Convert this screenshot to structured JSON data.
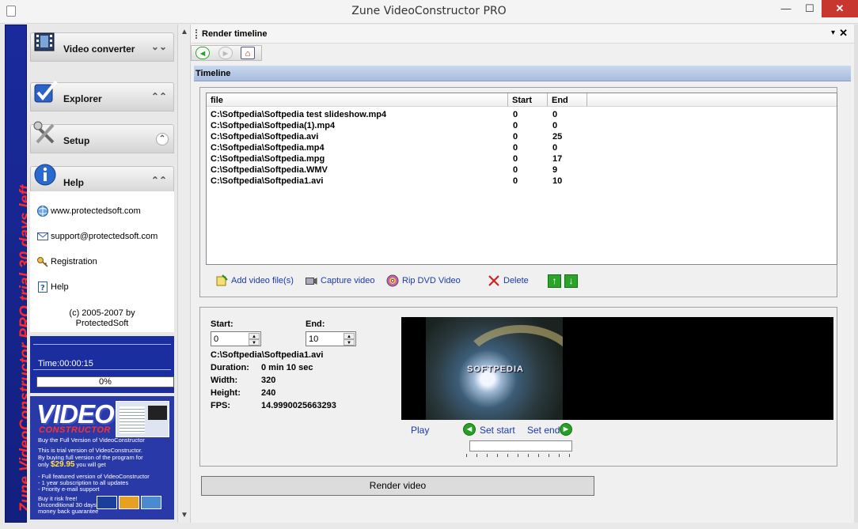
{
  "window": {
    "title": "Zune VideoConstructor PRO",
    "min": "—",
    "max": "☐",
    "close": "✕"
  },
  "trial_banner": "Zune VideoConstructor PRO trial 30 days left",
  "sidebar": {
    "sections": [
      {
        "label": "Video converter",
        "chevron": "⌄⌄"
      },
      {
        "label": "Explorer",
        "chevron": "⌃⌃"
      },
      {
        "label": "Setup",
        "chevron": "⌃"
      },
      {
        "label": "Help",
        "chevron": "⌃⌃"
      }
    ],
    "help_links": [
      {
        "label": "www.protectedsoft.com",
        "icon": "globe-icon"
      },
      {
        "label": "support@protectedsoft.com",
        "icon": "envelope-icon"
      },
      {
        "label": "Registration",
        "icon": "key-icon"
      },
      {
        "label": "Help",
        "icon": "help-book-icon"
      }
    ],
    "copyright_line1": "(c) 2005-2007 by",
    "copyright_line2": "ProtectedSoft",
    "status": {
      "time": "Time:00:00:15",
      "progress": "0%",
      "progress_value": 0
    },
    "ad": {
      "title": "VIDEO",
      "subtitle": "CONSTRUCTOR",
      "lines": [
        "Buy the Full Version of VideoConstructor",
        "This is trial version of VideoConstructor.",
        "By buying full version of the program for",
        "you will get",
        "- Full featured version of VideoConstructor",
        "- 1 year subscription to all updates",
        "- Priority e-mail support",
        "Buy it risk free!",
        "Unconditional 30 days",
        "money back guarantee"
      ],
      "price_prefix": "only",
      "price": "$29.95",
      "cards": [
        "VISA",
        "MC",
        "AMEX"
      ]
    }
  },
  "main": {
    "pane_title": "Render timeline",
    "pane_menu": "▾",
    "pane_close": "✕",
    "nav": {
      "back": "◄",
      "forward": "►",
      "home": "⌂"
    },
    "timeline_label": "Timeline",
    "columns": [
      "file",
      "Start",
      "End"
    ],
    "rows": [
      {
        "file": "C:\\Softpedia\\Softpedia test slideshow.mp4",
        "start": "0",
        "end": "0"
      },
      {
        "file": "C:\\Softpedia\\Softpedia(1).mp4",
        "start": "0",
        "end": "0"
      },
      {
        "file": "C:\\Softpedia\\Softpedia.avi",
        "start": "0",
        "end": "25"
      },
      {
        "file": "C:\\Softpedia\\Softpedia.mp4",
        "start": "0",
        "end": "0"
      },
      {
        "file": "C:\\Softpedia\\Softpedia.mpg",
        "start": "0",
        "end": "17"
      },
      {
        "file": "C:\\Softpedia\\Softpedia.WMV",
        "start": "0",
        "end": "9"
      },
      {
        "file": "C:\\Softpedia\\Softpedia1.avi",
        "start": "0",
        "end": "10"
      }
    ],
    "actions": {
      "add": "Add video file(s)",
      "capture": "Capture video",
      "rip": "Rip DVD Video",
      "delete": "Delete",
      "move_up": "↑",
      "move_down": "↓"
    },
    "details": {
      "start_label": "Start:",
      "start_value": "0",
      "end_label": "End:",
      "end_value": "10",
      "filename": "C:\\Softpedia\\Softpedia1.avi",
      "duration_label": "Duration:",
      "duration_value": "0 min 10 sec",
      "width_label": "Width:",
      "width_value": "320",
      "height_label": "Height:",
      "height_value": "240",
      "fps_label": "FPS:",
      "fps_value": "14.9990025663293"
    },
    "video": {
      "watermark": "SOFTPEDIA",
      "play": "Play",
      "set_start": "Set start",
      "set_end": "Set end",
      "arrow_left": "◄",
      "arrow_right": "►"
    },
    "render_button": "Render video"
  },
  "colors": {
    "trial_bg": "#1a2a9c",
    "trial_text": "#ff2a2a",
    "link": "#1a3aa8",
    "timeline_header": "#b8cae6",
    "action_green": "#2aa52a",
    "close_red": "#c7372f"
  }
}
